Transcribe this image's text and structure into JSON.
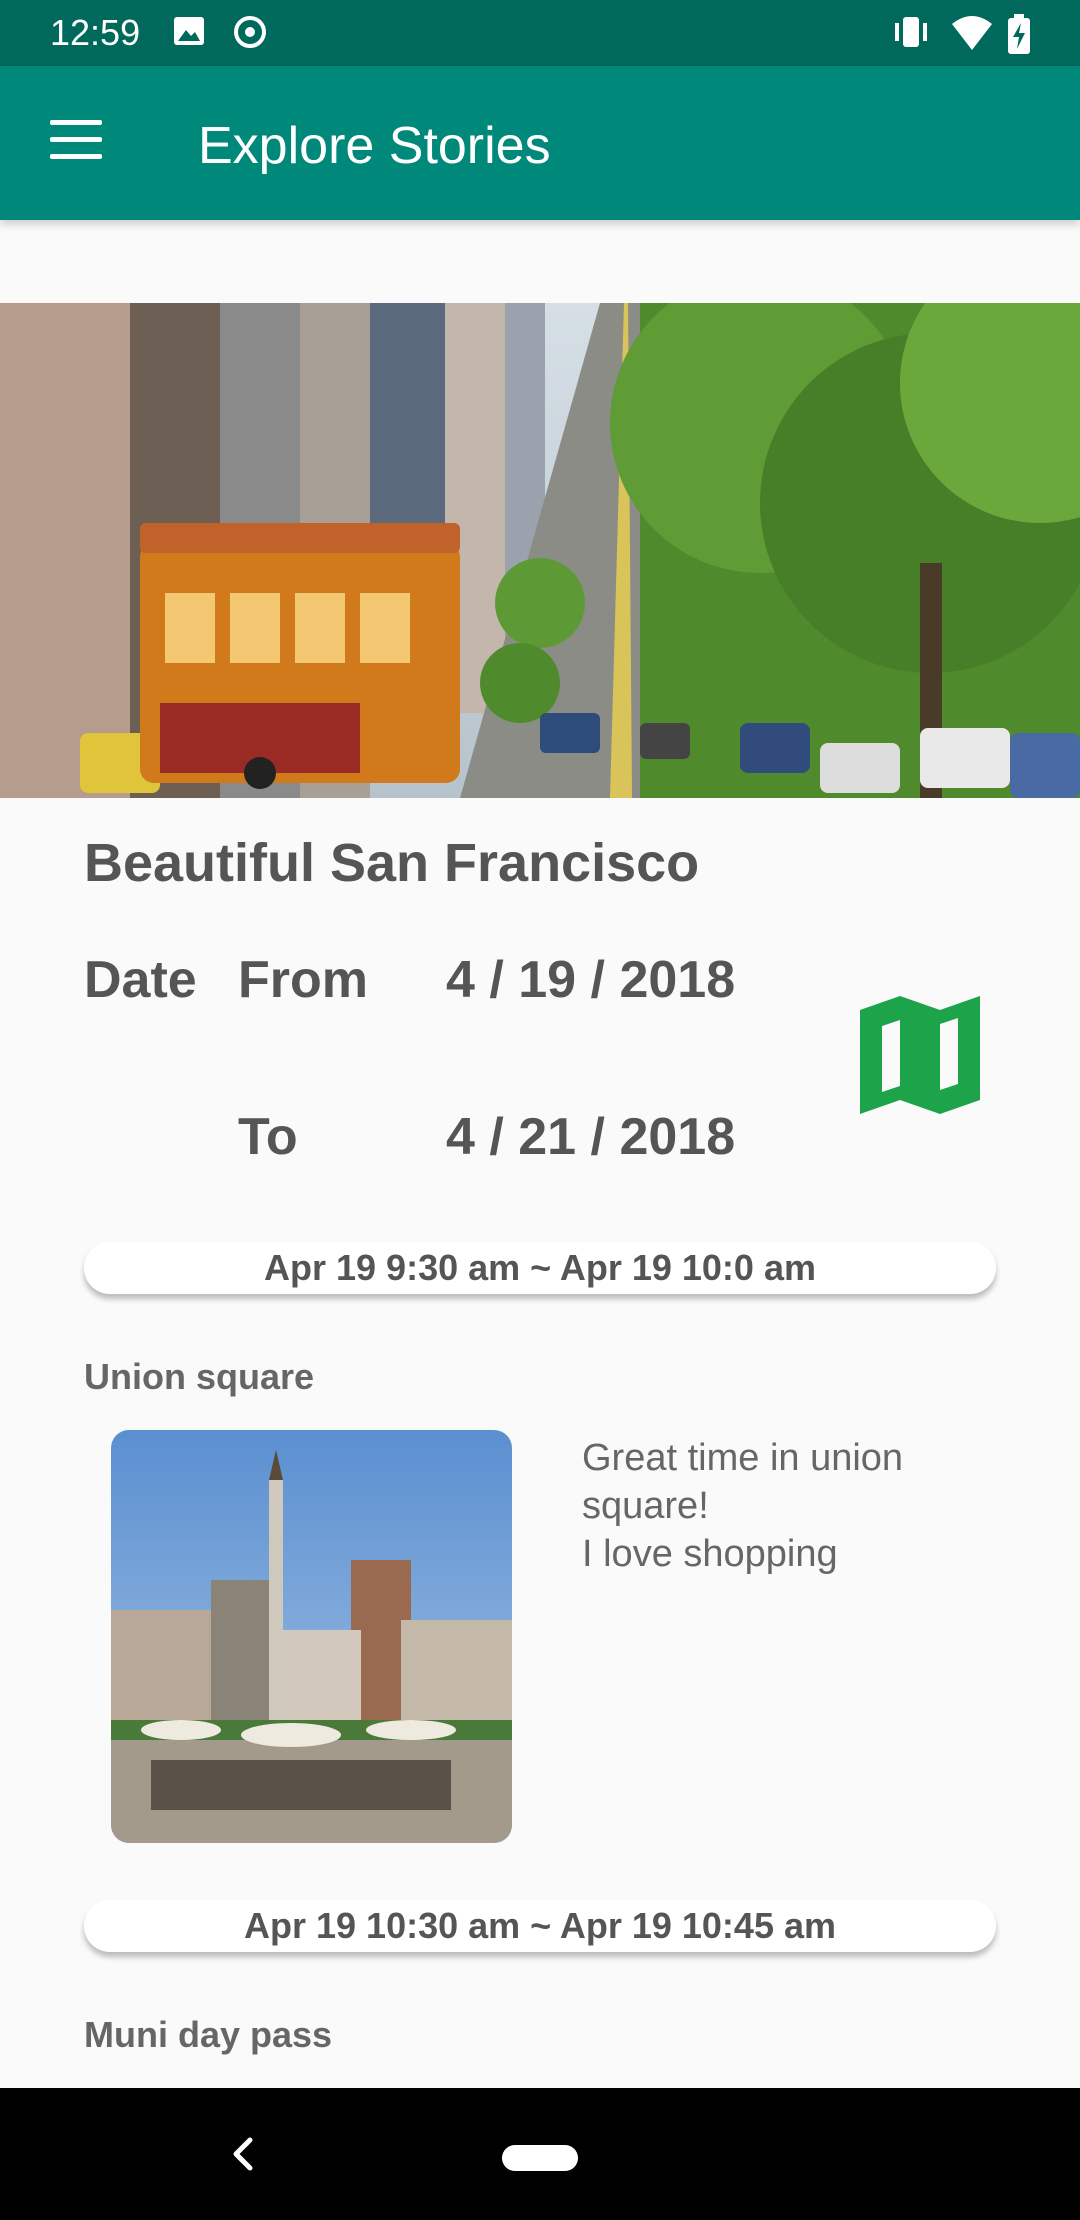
{
  "status_bar": {
    "time": "12:59"
  },
  "app_bar": {
    "title": "Explore Stories"
  },
  "story": {
    "title": "Beautiful San Francisco",
    "date_label": "Date",
    "from_label": "From",
    "from_date": "4 / 19 / 2018",
    "to_label": "To",
    "to_date": "4 / 21 / 2018"
  },
  "entries": [
    {
      "time_range": "Apr 19 9:30 am ~ Apr 19 10:0 am",
      "place": "Union square",
      "description": "Great time in union square!\nI love shopping"
    },
    {
      "time_range": "Apr 19 10:30 am ~ Apr 19 10:45 am",
      "place": "Muni day pass"
    }
  ],
  "colors": {
    "status_bar": "#00695c",
    "app_bar": "#00897b",
    "map_icon": "#1da34a",
    "background": "#fafafa"
  },
  "icons": {
    "menu": "menu-icon",
    "map": "map-icon",
    "back": "back-icon"
  }
}
